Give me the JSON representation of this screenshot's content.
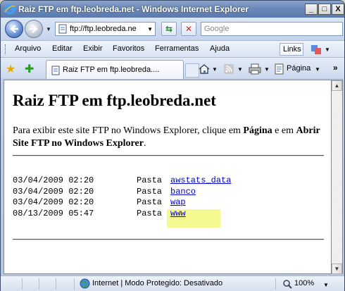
{
  "window": {
    "title": "Raiz FTP em ftp.leobreda.net - Windows Internet Explorer",
    "minimize": "_",
    "maximize": "□",
    "close": "X"
  },
  "nav": {
    "address": "ftp://ftp.leobreda.ne",
    "search_placeholder": "Google"
  },
  "menu": {
    "items": [
      "Arquivo",
      "Editar",
      "Exibir",
      "Favoritos",
      "Ferramentas",
      "Ajuda"
    ],
    "links": "Links"
  },
  "tab": {
    "label": "Raiz FTP em ftp.leobreda...."
  },
  "toolbar": {
    "page_label": "Página"
  },
  "page": {
    "heading": "Raiz FTP em ftp.leobreda.net",
    "intro_part1": "Para exibir este site FTP no Windows Explorer, clique em ",
    "intro_bold1": "Página",
    "intro_part2": " e em ",
    "intro_bold2": "Abrir Site FTP no Windows Explorer",
    "intro_end": ".",
    "entries": [
      {
        "date": "03/04/2009 02:20",
        "kind": "Pasta",
        "name": "awstats_data"
      },
      {
        "date": "03/04/2009 02:20",
        "kind": "Pasta",
        "name": "banco"
      },
      {
        "date": "03/04/2009 02:20",
        "kind": "Pasta",
        "name": "wap"
      },
      {
        "date": "08/13/2009 05:47",
        "kind": "Pasta",
        "name": "www"
      }
    ]
  },
  "status": {
    "zone": "Internet | Modo Protegido: Desativado",
    "zoom": "100%"
  },
  "colors": {
    "link": "#0000cc",
    "highlight": "#f6f98f"
  }
}
